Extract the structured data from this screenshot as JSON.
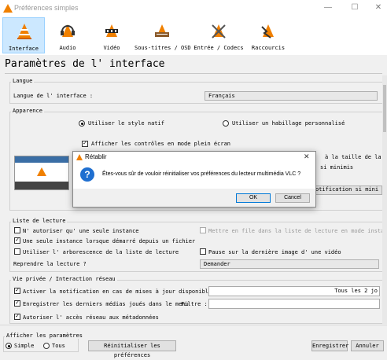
{
  "window": {
    "title": "Préférences simples",
    "controls": [
      "—",
      "☐",
      "✕"
    ]
  },
  "toolbar": {
    "items": [
      {
        "label": "Interface",
        "icon": "interface-cone-icon",
        "selected": true
      },
      {
        "label": "Audio",
        "icon": "headphones-cone-icon",
        "selected": false
      },
      {
        "label": "Vidéo",
        "icon": "video-cone-icon",
        "selected": false
      },
      {
        "label": "Sous-titres / OSD",
        "icon": "subtitles-cone-icon",
        "selected": false
      },
      {
        "label": "Entrée / Codecs",
        "icon": "codecs-cone-icon",
        "selected": false
      },
      {
        "label": "Raccourcis",
        "icon": "hotkeys-cone-icon",
        "selected": false
      }
    ]
  },
  "page_title": "Paramètres de l' interface",
  "langue": {
    "group": "Langue",
    "label": "Langue de l' interface :",
    "value": "Français"
  },
  "apparence": {
    "group": "Apparence",
    "native": "Utiliser le style natif",
    "custom": "Utiliser un habillage personnalisé",
    "fullscreen": "Afficher les contrôles en mode plein écran",
    "right1": "à la taille de la v",
    "right2": "si minimis",
    "right_btn": "otification si mini"
  },
  "playlist": {
    "group": "Liste de lecture",
    "one_instance": "N' autoriser qu' une seule instance",
    "enqueue": "Mettre en file dans la liste de lecture en mode instance",
    "single_file": "Une seule instance lorsque démarré depuis un fichier",
    "tree": "Utiliser l' arborescence de la liste de lecture",
    "pause_last": "Pause sur la dernière image d' une vidéo",
    "resume_label": "Reprendre la lecture ?",
    "resume_value": "Demander"
  },
  "privacy": {
    "group": "Vie privée / Interaction réseau",
    "updates": "Activer la notification en cas de mises à jour disponible",
    "updates_value": "Tous les 2 jo",
    "recent": "Enregistrer les derniers médias joués dans le menu",
    "filter_label": "Filtre :",
    "network": "Autoriser l' accès réseau aux métadonnées"
  },
  "footer": {
    "show_label": "Afficher les paramètres",
    "simple": "Simple",
    "all": "Tous",
    "reset": "Réinitialiser les préférences",
    "save": "Enregistrer",
    "cancel": "Annuler"
  },
  "dialog": {
    "title": "Rétablir",
    "message": "Êtes-vous sûr de vouloir réinitialiser vos préférences du lecteur multimédia VLC ?",
    "ok": "OK",
    "cancel": "Cancel",
    "close": "✕",
    "icon": "question-icon"
  },
  "colors": {
    "accent": "#0078d7",
    "selected_tab": "#cce8ff",
    "cone": "#f08000"
  }
}
